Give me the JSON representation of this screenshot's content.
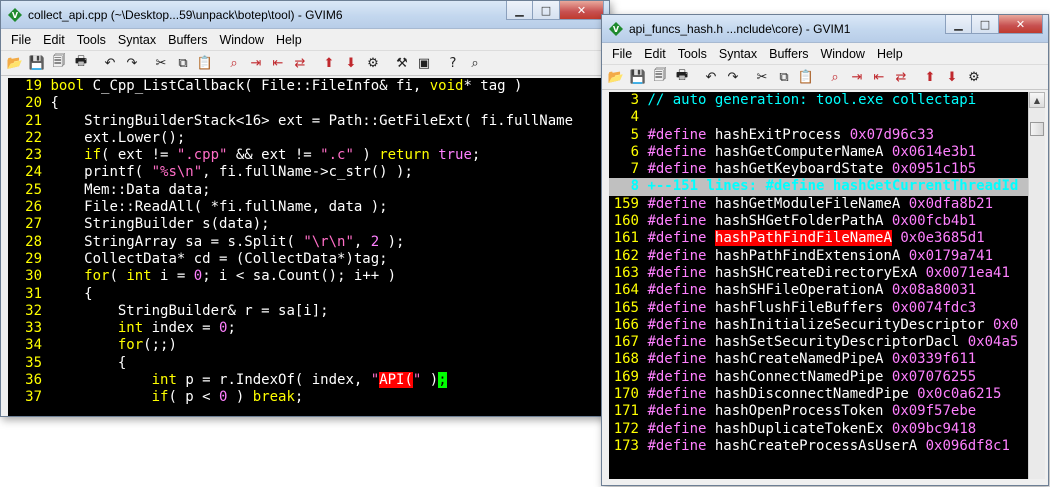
{
  "colors": {
    "editor_bg": "#000000",
    "line_number": "#ffff00",
    "keyword": "#ffff00",
    "string": "#ff6ec7",
    "preproc": "#ff80ff",
    "comment": "#00ffff",
    "search_highlight": "#ff0000",
    "cursor": "#00ff00"
  },
  "menu": [
    "File",
    "Edit",
    "Tools",
    "Syntax",
    "Buffers",
    "Window",
    "Help"
  ],
  "windows": {
    "left": {
      "title": "collect_api.cpp (~\\Desktop...59\\unpack\\botep\\tool) - GVIM6",
      "lines": [
        {
          "n": "19",
          "segs": [
            [
              "c-type",
              "bool"
            ],
            [
              "c-id",
              " C_Cpp_ListCallback( File::FileInfo& fi, "
            ],
            [
              "c-type",
              "void"
            ],
            [
              "c-id",
              "* tag )"
            ]
          ]
        },
        {
          "n": "20",
          "segs": [
            [
              "c-id",
              "{"
            ]
          ]
        },
        {
          "n": "21",
          "segs": [
            [
              "c-id",
              "    StringBuilderStack<16> ext = Path::GetFileExt( fi.fullName"
            ]
          ]
        },
        {
          "n": "22",
          "segs": [
            [
              "c-id",
              "    ext.Lower();"
            ]
          ]
        },
        {
          "n": "23",
          "segs": [
            [
              "c-id",
              "    "
            ],
            [
              "c-kw",
              "if"
            ],
            [
              "c-id",
              "( ext != "
            ],
            [
              "c-str",
              "\".cpp\""
            ],
            [
              "c-id",
              " && ext != "
            ],
            [
              "c-str",
              "\".c\""
            ],
            [
              "c-id",
              " ) "
            ],
            [
              "c-kw",
              "return"
            ],
            [
              "c-id",
              " "
            ],
            [
              "c-num",
              "true"
            ],
            [
              "c-id",
              ";"
            ]
          ]
        },
        {
          "n": "24",
          "segs": [
            [
              "c-id",
              "    printf( "
            ],
            [
              "c-str",
              "\"%s\\n\""
            ],
            [
              "c-id",
              ", fi.fullName->c_str() );"
            ]
          ]
        },
        {
          "n": "25",
          "segs": [
            [
              "c-id",
              "    Mem::Data data;"
            ]
          ]
        },
        {
          "n": "26",
          "segs": [
            [
              "c-id",
              "    File::ReadAll( *fi.fullName, data );"
            ]
          ]
        },
        {
          "n": "27",
          "segs": [
            [
              "c-id",
              "    StringBuilder s(data);"
            ]
          ]
        },
        {
          "n": "28",
          "segs": [
            [
              "c-id",
              "    StringArray sa = s.Split( "
            ],
            [
              "c-str",
              "\"\\r\\n\""
            ],
            [
              "c-id",
              ", "
            ],
            [
              "c-num",
              "2"
            ],
            [
              "c-id",
              " );"
            ]
          ]
        },
        {
          "n": "29",
          "segs": [
            [
              "c-id",
              "    CollectData* cd = (CollectData*)tag;"
            ]
          ]
        },
        {
          "n": "30",
          "segs": [
            [
              "c-id",
              "    "
            ],
            [
              "c-kw",
              "for"
            ],
            [
              "c-id",
              "( "
            ],
            [
              "c-type",
              "int"
            ],
            [
              "c-id",
              " i = "
            ],
            [
              "c-num",
              "0"
            ],
            [
              "c-id",
              "; i < sa.Count(); i++ )"
            ]
          ]
        },
        {
          "n": "31",
          "segs": [
            [
              "c-id",
              "    {"
            ]
          ]
        },
        {
          "n": "32",
          "segs": [
            [
              "c-id",
              "        StringBuilder& r = sa[i];"
            ]
          ]
        },
        {
          "n": "33",
          "segs": [
            [
              "c-id",
              "        "
            ],
            [
              "c-type",
              "int"
            ],
            [
              "c-id",
              " index = "
            ],
            [
              "c-num",
              "0"
            ],
            [
              "c-id",
              ";"
            ]
          ]
        },
        {
          "n": "34",
          "segs": [
            [
              "c-id",
              "        "
            ],
            [
              "c-kw",
              "for"
            ],
            [
              "c-id",
              "(;;)"
            ]
          ]
        },
        {
          "n": "35",
          "segs": [
            [
              "c-id",
              "        {"
            ]
          ]
        },
        {
          "n": "36",
          "segs": [
            [
              "c-id",
              "            "
            ],
            [
              "c-type",
              "int"
            ],
            [
              "c-id",
              " p = r.IndexOf( index, "
            ],
            [
              "c-str",
              "\""
            ],
            [
              "hl-red",
              "API("
            ],
            [
              "c-str",
              "\""
            ],
            [
              "c-id",
              " )"
            ],
            [
              "cursor",
              ";"
            ]
          ]
        },
        {
          "n": "37",
          "segs": [
            [
              "c-id",
              "            "
            ],
            [
              "c-kw",
              "if"
            ],
            [
              "c-id",
              "( p < "
            ],
            [
              "c-num",
              "0"
            ],
            [
              "c-id",
              " ) "
            ],
            [
              "c-kw",
              "break"
            ],
            [
              "c-id",
              ";"
            ]
          ]
        }
      ]
    },
    "right": {
      "title": "api_funcs_hash.h ...nclude\\core) - GVIM1",
      "lines": [
        {
          "n": "3",
          "segs": [
            [
              "c-cmt",
              "// auto generation: tool.exe collectapi"
            ]
          ]
        },
        {
          "n": "4",
          "segs": []
        },
        {
          "n": "5",
          "segs": [
            [
              "c-pre",
              "#define"
            ],
            [
              "c-id",
              " hashExitProcess "
            ],
            [
              "c-num",
              "0x07d96c33"
            ]
          ]
        },
        {
          "n": "6",
          "segs": [
            [
              "c-pre",
              "#define"
            ],
            [
              "c-id",
              " hashGetComputerNameA "
            ],
            [
              "c-num",
              "0x0614e3b1"
            ]
          ]
        },
        {
          "n": "7",
          "segs": [
            [
              "c-pre",
              "#define"
            ],
            [
              "c-id",
              " hashGetKeyboardState "
            ],
            [
              "c-num",
              "0x0951c1b5"
            ]
          ]
        },
        {
          "n": "8",
          "fold": true,
          "text": "+--151 lines: #define hashGetCurrentThreadId"
        },
        {
          "n": "159",
          "segs": [
            [
              "c-pre",
              "#define"
            ],
            [
              "c-id",
              " hashGetModuleFileNameA "
            ],
            [
              "c-num",
              "0x0dfa8b21"
            ]
          ]
        },
        {
          "n": "160",
          "segs": [
            [
              "c-pre",
              "#define"
            ],
            [
              "c-id",
              " hashSHGetFolderPathA "
            ],
            [
              "c-num",
              "0x00fcb4b1"
            ]
          ]
        },
        {
          "n": "161",
          "segs": [
            [
              "c-pre",
              "#define"
            ],
            [
              "c-id",
              " "
            ],
            [
              "hl-red",
              "hashPathFindFileNameA"
            ],
            [
              "c-id",
              " "
            ],
            [
              "c-num",
              "0x0e3685d1"
            ]
          ]
        },
        {
          "n": "162",
          "segs": [
            [
              "c-pre",
              "#define"
            ],
            [
              "c-id",
              " hashPathFindExtensionA "
            ],
            [
              "c-num",
              "0x0179a741"
            ]
          ]
        },
        {
          "n": "163",
          "segs": [
            [
              "c-pre",
              "#define"
            ],
            [
              "c-id",
              " hashSHCreateDirectoryExA "
            ],
            [
              "c-num",
              "0x0071ea41"
            ]
          ]
        },
        {
          "n": "164",
          "segs": [
            [
              "c-pre",
              "#define"
            ],
            [
              "c-id",
              " hashSHFileOperationA "
            ],
            [
              "c-num",
              "0x08a80031"
            ]
          ]
        },
        {
          "n": "165",
          "segs": [
            [
              "c-pre",
              "#define"
            ],
            [
              "c-id",
              " hashFlushFileBuffers "
            ],
            [
              "c-num",
              "0x0074fdc3"
            ]
          ]
        },
        {
          "n": "166",
          "segs": [
            [
              "c-pre",
              "#define"
            ],
            [
              "c-id",
              " hashInitializeSecurityDescriptor "
            ],
            [
              "c-num",
              "0x0"
            ]
          ]
        },
        {
          "n": "167",
          "segs": [
            [
              "c-pre",
              "#define"
            ],
            [
              "c-id",
              " hashSetSecurityDescriptorDacl "
            ],
            [
              "c-num",
              "0x04a5"
            ]
          ]
        },
        {
          "n": "168",
          "segs": [
            [
              "c-pre",
              "#define"
            ],
            [
              "c-id",
              " hashCreateNamedPipeA "
            ],
            [
              "c-num",
              "0x0339f611"
            ]
          ]
        },
        {
          "n": "169",
          "segs": [
            [
              "c-pre",
              "#define"
            ],
            [
              "c-id",
              " hashConnectNamedPipe "
            ],
            [
              "c-num",
              "0x07076255"
            ]
          ]
        },
        {
          "n": "170",
          "segs": [
            [
              "c-pre",
              "#define"
            ],
            [
              "c-id",
              " hashDisconnectNamedPipe "
            ],
            [
              "c-num",
              "0x0c0a6215"
            ]
          ]
        },
        {
          "n": "171",
          "segs": [
            [
              "c-pre",
              "#define"
            ],
            [
              "c-id",
              " hashOpenProcessToken "
            ],
            [
              "c-num",
              "0x09f57ebe"
            ]
          ]
        },
        {
          "n": "172",
          "segs": [
            [
              "c-pre",
              "#define"
            ],
            [
              "c-id",
              " hashDuplicateTokenEx "
            ],
            [
              "c-num",
              "0x09bc9418"
            ]
          ]
        },
        {
          "n": "173",
          "segs": [
            [
              "c-pre",
              "#define"
            ],
            [
              "c-id",
              " hashCreateProcessAsUserA "
            ],
            [
              "c-num",
              "0x096df8c1"
            ]
          ]
        }
      ]
    }
  }
}
